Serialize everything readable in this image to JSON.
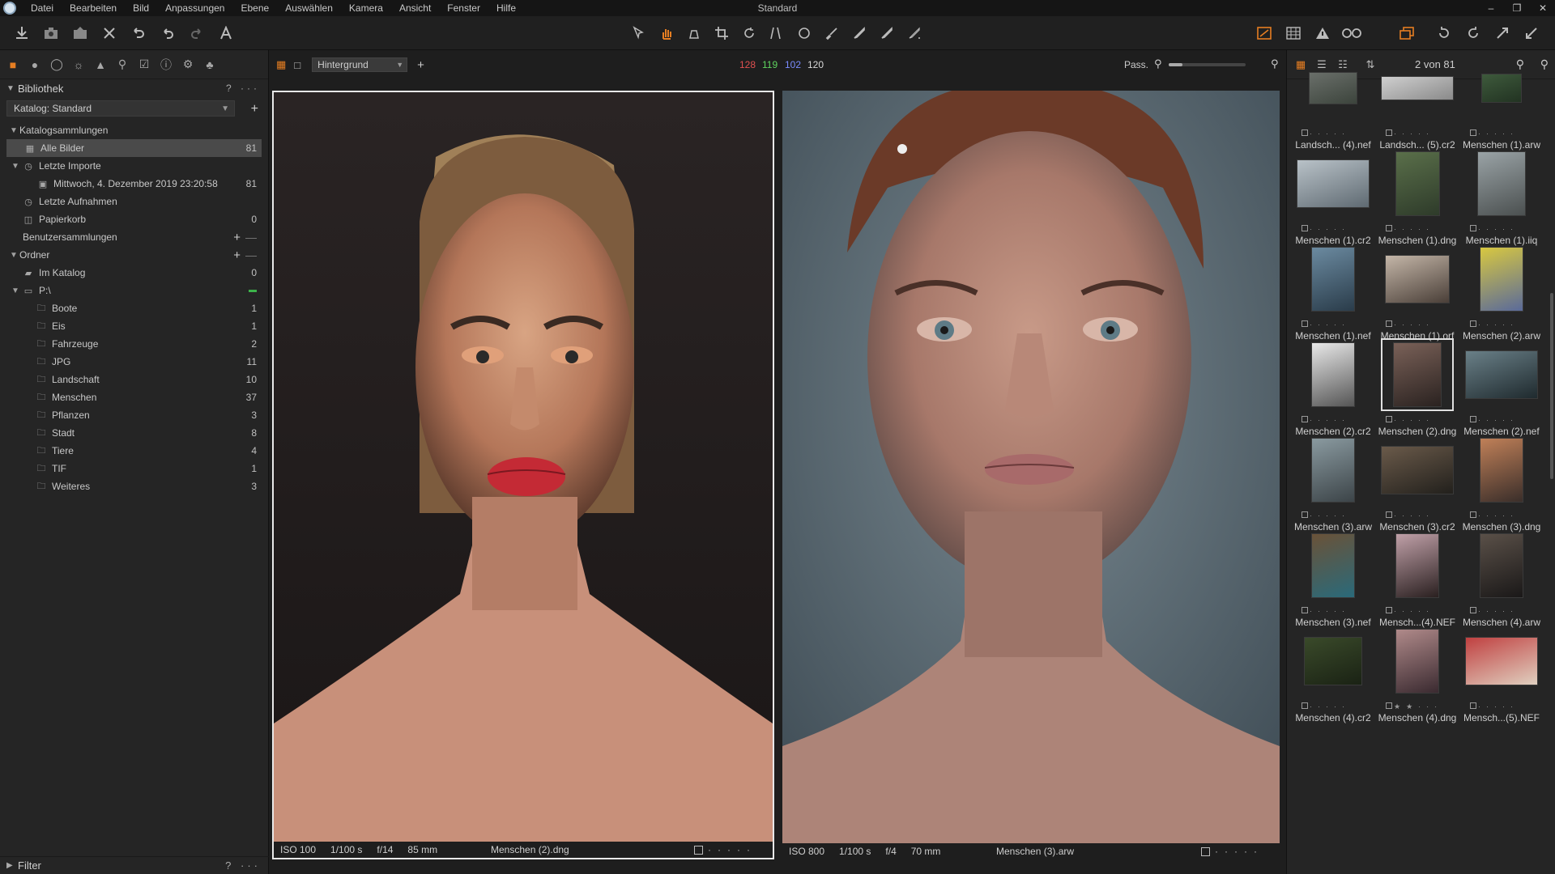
{
  "app": {
    "window_title": "Standard",
    "menu": [
      "Datei",
      "Bearbeiten",
      "Bild",
      "Anpassungen",
      "Ebene",
      "Auswählen",
      "Kamera",
      "Ansicht",
      "Fenster",
      "Hilfe"
    ],
    "window_controls": [
      "–",
      "❐",
      "✕"
    ]
  },
  "toolbar": {
    "left_icons": [
      "import-icon",
      "camera-icon",
      "export-icon",
      "delete-icon",
      "undo-all-icon",
      "undo-icon",
      "redo-icon",
      "text-icon"
    ],
    "center_icons": [
      "select-icon",
      "pan-icon",
      "loupe-icon",
      "crop-icon",
      "rotate-icon",
      "keystone-icon",
      "spot-icon",
      "brush-icon",
      "draw-mask-icon",
      "erase-mask-icon",
      "gradient-icon"
    ],
    "right_icons": [
      "exposure-warning-icon",
      "grid-icon",
      "warning-icon",
      "proof-icon",
      "sessions-icon",
      "rotate-left-icon",
      "rotate-right-icon",
      "expand-icon",
      "collapse-icon"
    ]
  },
  "library": {
    "title": "Bibliothek",
    "help": "?",
    "catalog_select": "Katalog: Standard",
    "sections": {
      "catalog_collections": "Katalogsammlungen",
      "user_collections": "Benutzersammlungen",
      "folders": "Ordner"
    },
    "catalog_items": [
      {
        "label": "Alle Bilder",
        "count": "81",
        "icon": "images-icon"
      },
      {
        "label": "Letzte Importe",
        "count": "",
        "icon": "clock-icon"
      },
      {
        "label": "Mittwoch, 4. Dezember 2019 23:20:58",
        "count": "81",
        "icon": "album-icon"
      },
      {
        "label": "Letzte Aufnahmen",
        "count": "",
        "icon": "clock-icon"
      },
      {
        "label": "Papierkorb",
        "count": "0",
        "icon": "trash-icon"
      }
    ],
    "folder_items": [
      {
        "label": "Im Katalog",
        "count": "0"
      },
      {
        "label": "P:\\",
        "count": ""
      },
      {
        "label": "Boote",
        "count": "1"
      },
      {
        "label": "Eis",
        "count": "1"
      },
      {
        "label": "Fahrzeuge",
        "count": "2"
      },
      {
        "label": "JPG",
        "count": "11"
      },
      {
        "label": "Landschaft",
        "count": "10"
      },
      {
        "label": "Menschen",
        "count": "37"
      },
      {
        "label": "Pflanzen",
        "count": "3"
      },
      {
        "label": "Stadt",
        "count": "8"
      },
      {
        "label": "Tiere",
        "count": "4"
      },
      {
        "label": "TIF",
        "count": "1"
      },
      {
        "label": "Weiteres",
        "count": "3"
      }
    ],
    "filter_label": "Filter"
  },
  "viewer": {
    "layer_select": "Hintergrund",
    "rgb": {
      "r": "128",
      "g": "119",
      "b": "102",
      "l": "120"
    },
    "colors": {
      "r": "#e05050",
      "g": "#5fd45f",
      "b": "#7a8cff",
      "l": "#d8d8d8"
    },
    "zoom_label": "Pass.",
    "zoom_level": 0.18,
    "left": {
      "iso": "ISO 100",
      "shutter": "1/100 s",
      "aperture": "f/14",
      "focal": "85 mm",
      "filename": "Menschen (2).dng"
    },
    "right": {
      "iso": "ISO 800",
      "shutter": "1/100 s",
      "aperture": "f/4",
      "focal": "70 mm",
      "filename": "Menschen (3).arw"
    }
  },
  "browser": {
    "count_label": "2 von 81",
    "thumbs": [
      {
        "name": "Landsch... (4).nef",
        "rating": 0
      },
      {
        "name": "Landsch... (5).cr2",
        "rating": 0
      },
      {
        "name": "Menschen (1).arw",
        "rating": 0
      },
      {
        "name": "Menschen (1).cr2",
        "rating": 0
      },
      {
        "name": "Menschen (1).dng",
        "rating": 0
      },
      {
        "name": "Menschen (1).iiq",
        "rating": 0
      },
      {
        "name": "Menschen (1).nef",
        "rating": 0
      },
      {
        "name": "Menschen (1).orf",
        "rating": 0
      },
      {
        "name": "Menschen (2).arw",
        "rating": 0
      },
      {
        "name": "Menschen (2).cr2",
        "rating": 0
      },
      {
        "name": "Menschen (2).dng",
        "rating": 0
      },
      {
        "name": "Menschen (2).nef",
        "rating": 0
      },
      {
        "name": "Menschen (3).arw",
        "rating": 0
      },
      {
        "name": "Menschen (3).cr2",
        "rating": 0
      },
      {
        "name": "Menschen (3).dng",
        "rating": 0
      },
      {
        "name": "Menschen (3).nef",
        "rating": 0
      },
      {
        "name": "Mensch...(4).NEF",
        "rating": 0
      },
      {
        "name": "Menschen (4).arw",
        "rating": 0
      },
      {
        "name": "Menschen (4).cr2",
        "rating": 0
      },
      {
        "name": "Menschen (4).dng",
        "rating": 2
      },
      {
        "name": "Mensch...(5).NEF",
        "rating": 0
      }
    ]
  },
  "accent_color": "#e67e22"
}
